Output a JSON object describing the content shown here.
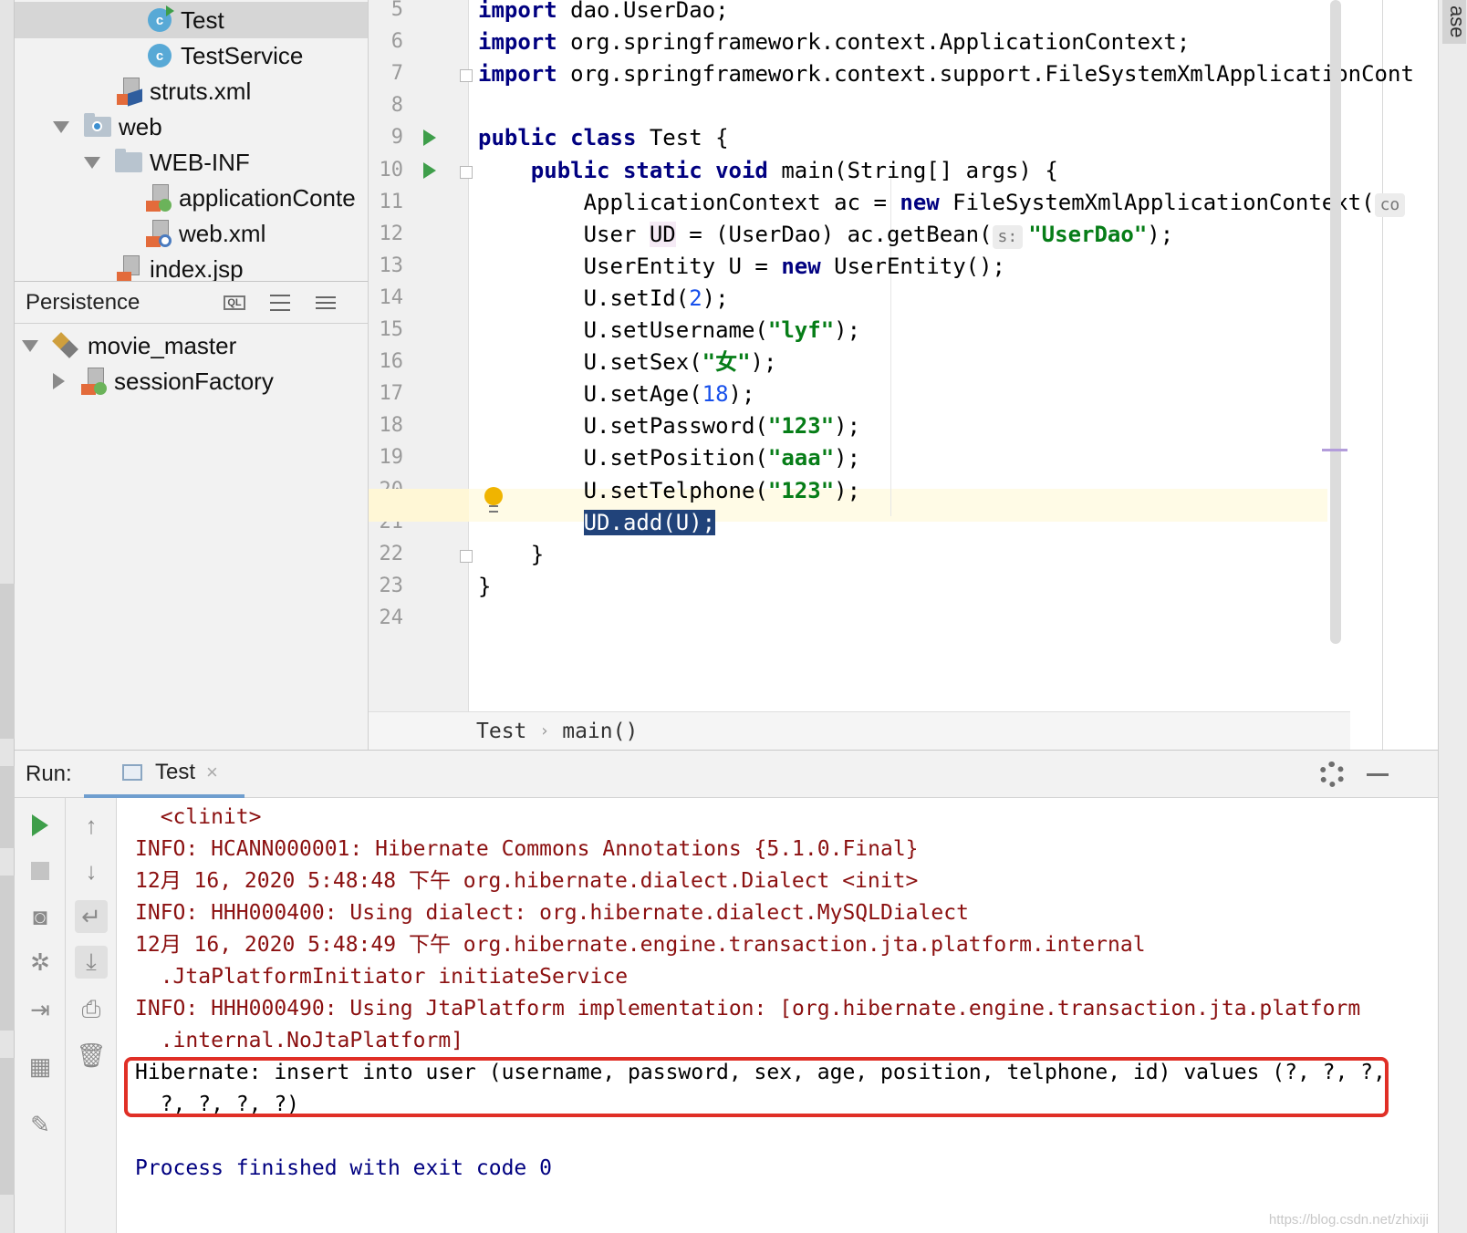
{
  "project_tree": [
    {
      "label": "Test",
      "type": "class-run",
      "depth": 1,
      "selected": true
    },
    {
      "label": "TestService",
      "type": "class",
      "depth": 1
    },
    {
      "label": "struts.xml",
      "type": "xml-struts",
      "depth": 2
    },
    {
      "label": "web",
      "type": "web-folder",
      "expanded": true,
      "depth": 3
    },
    {
      "label": "WEB-INF",
      "type": "folder",
      "expanded": true,
      "depth": 4
    },
    {
      "label": "applicationConte",
      "type": "xml-spring",
      "depth": 5
    },
    {
      "label": "web.xml",
      "type": "xml-web",
      "depth": 5
    },
    {
      "label": "index.jsp",
      "type": "jsp",
      "depth": 2
    }
  ],
  "persistence": {
    "title": "Persistence",
    "ql_label": "QL",
    "items": [
      {
        "label": "movie_master",
        "expanded": true
      },
      {
        "label": "sessionFactory",
        "expanded": false
      }
    ]
  },
  "right_strip": {
    "tab_label": "ase"
  },
  "editor": {
    "line_numbers": [
      "5",
      "6",
      "7",
      "8",
      "9",
      "10",
      "11",
      "12",
      "13",
      "14",
      "15",
      "16",
      "17",
      "18",
      "19",
      "20",
      "21",
      "22",
      "23",
      "24"
    ],
    "lines": [
      {
        "kw": "import",
        "text": " dao.UserDao;"
      },
      {
        "kw": "import",
        "text": " org.springframework.context.ApplicationContext;"
      },
      {
        "kw": "import",
        "text": " org.springframework.context.support.FileSystemXmlApplicationCont"
      },
      {
        "text": ""
      },
      {
        "kw": "public class",
        "text": " Test {"
      },
      {
        "indent": "    ",
        "kw": "public static void",
        "text": " main(String[] args) {"
      },
      {
        "indent": "        ",
        "pre": "ApplicationContext ac = ",
        "kw": "new",
        "text": " FileSystemXmlApplicationContext(",
        "hint": "co"
      },
      {
        "indent": "        ",
        "pre": "User ",
        "var": "UD",
        "mid": " = (UserDao) ac.getBean(",
        "hint": "s:",
        "str": "\"UserDao\"",
        "post": ");"
      },
      {
        "indent": "        ",
        "pre": "UserEntity U = ",
        "kw": "new",
        "text": " UserEntity();"
      },
      {
        "indent": "        ",
        "pre": "U.setId(",
        "num": "2",
        "post": ");"
      },
      {
        "indent": "        ",
        "pre": "U.setUsername(",
        "str": "\"lyf\"",
        "post": ");"
      },
      {
        "indent": "        ",
        "pre": "U.setSex(",
        "str": "\"女\"",
        "post": ");"
      },
      {
        "indent": "        ",
        "pre": "U.setAge(",
        "num": "18",
        "post": ");"
      },
      {
        "indent": "        ",
        "pre": "U.setPassword(",
        "str": "\"123\"",
        "post": ");"
      },
      {
        "indent": "        ",
        "pre": "U.setPosition(",
        "str": "\"aaa\"",
        "post": ");"
      },
      {
        "indent": "        ",
        "pre": "U.setTelphone(",
        "str": "\"123\"",
        "post": ");"
      },
      {
        "indent": "        ",
        "selected": "UD.add(U);"
      },
      {
        "indent": "    ",
        "text": "}"
      },
      {
        "text": "}"
      },
      {
        "text": ""
      }
    ],
    "breadcrumb": [
      "Test",
      "main()"
    ],
    "breadcrumb_sep": "›"
  },
  "run": {
    "label": "Run:",
    "tab": "Test",
    "tab_close": "×",
    "console": [
      {
        "text": "  <clinit>",
        "style": "error"
      },
      {
        "text": "INFO: HCANN000001: Hibernate Commons Annotations {5.1.0.Final}",
        "style": "error"
      },
      {
        "text": "12月 16, 2020 5:48:48 下午 org.hibernate.dialect.Dialect <init>",
        "style": "error"
      },
      {
        "text": "INFO: HHH000400: Using dialect: org.hibernate.dialect.MySQLDialect",
        "style": "error"
      },
      {
        "text": "12月 16, 2020 5:48:49 下午 org.hibernate.engine.transaction.jta.platform.internal",
        "style": "error"
      },
      {
        "text": "  .JtaPlatformInitiator initiateService",
        "style": "error"
      },
      {
        "text": "INFO: HHH000490: Using JtaPlatform implementation: [org.hibernate.engine.transaction.jta.platform",
        "style": "error"
      },
      {
        "text": "  .internal.NoJtaPlatform]",
        "style": "error"
      },
      {
        "text": "Hibernate: insert into user (username, password, sex, age, position, telphone, id) values (?, ?, ?,",
        "style": "normal"
      },
      {
        "text": "  ?, ?, ?, ?)",
        "style": "normal"
      },
      {
        "text": "",
        "style": "normal"
      },
      {
        "text": "Process finished with exit code 0",
        "style": "blue"
      }
    ],
    "watermark": "https://blog.csdn.net/zhixiji"
  },
  "colors": {
    "keyword": "#000080",
    "string": "#067d17",
    "number": "#1750eb",
    "console_error": "#8b1010",
    "highlight_box": "#e02f26",
    "selection": "#21437a"
  }
}
